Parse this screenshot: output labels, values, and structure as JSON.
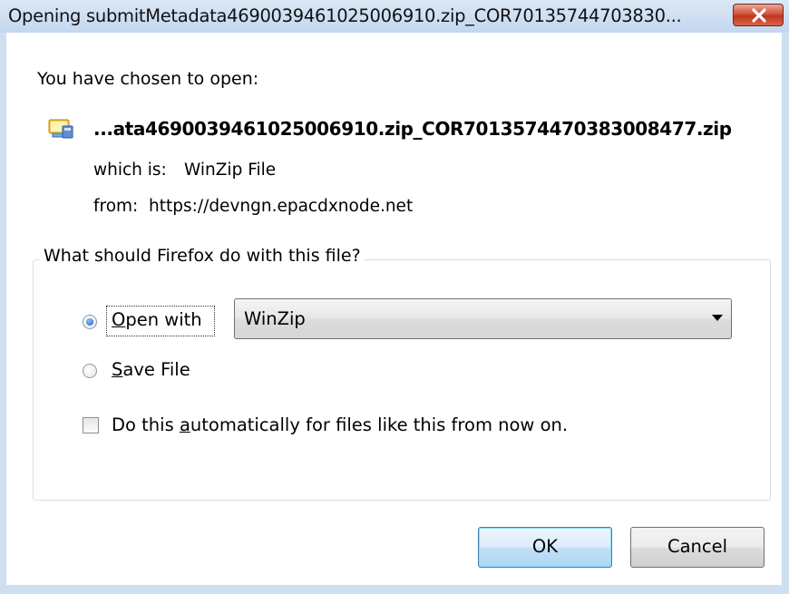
{
  "window": {
    "title": "Opening submitMetadata4690039461025006910.zip_COR70135744703830..."
  },
  "dialog": {
    "chosen_label": "You have chosen to open:",
    "file_name": "...ata4690039461025006910.zip_COR7013574470383008477.zip",
    "file_icon": "winzip-file-icon",
    "which_is_label": "which is:",
    "which_is_value": "WinZip File",
    "from_label": "from:",
    "from_value": "https://devngn.epacdxnode.net"
  },
  "action_group": {
    "legend": "What should Firefox do with this file?",
    "open_with": {
      "label": "Open with",
      "mnemonic": "O",
      "rest": "pen with",
      "selected": true
    },
    "open_with_app": "WinZip",
    "save_file": {
      "label": "Save File",
      "mnemonic": "S",
      "rest": "ave File",
      "selected": false
    },
    "auto_checkbox": {
      "label": "Do this automatically for files like this from now on.",
      "before": "Do this ",
      "mnemonic": "a",
      "after": "utomatically for files like this from now on.",
      "checked": false
    }
  },
  "buttons": {
    "ok": "OK",
    "cancel": "Cancel"
  },
  "colors": {
    "frame": "#cddff1",
    "close_button": "#c7432c",
    "default_button_border": "#3c7fb1"
  }
}
